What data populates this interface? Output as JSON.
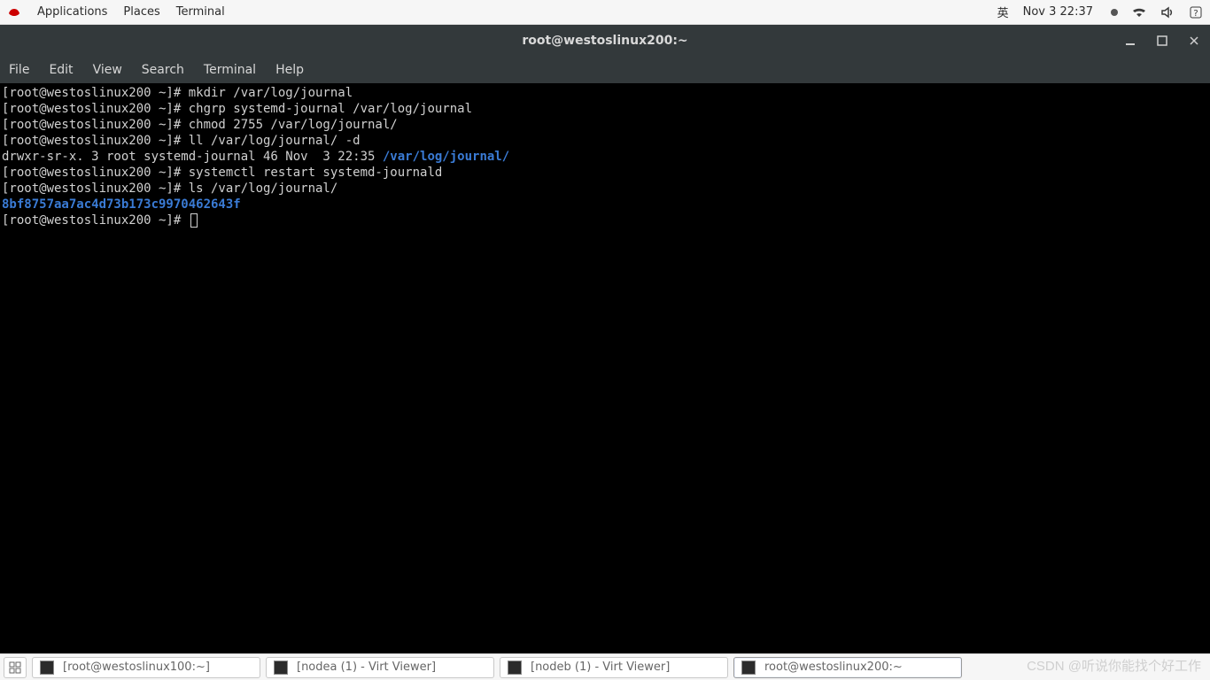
{
  "top_panel": {
    "applications": "Applications",
    "places": "Places",
    "terminal": "Terminal",
    "ime": "英",
    "clock": "Nov 3  22:37"
  },
  "window": {
    "title": "root@westoslinux200:~"
  },
  "menubar": {
    "file": "File",
    "edit": "Edit",
    "view": "View",
    "search": "Search",
    "terminal": "Terminal",
    "help": "Help"
  },
  "terminal": {
    "lines": [
      {
        "prompt": "[root@westoslinux200 ~]# ",
        "cmd": "mkdir /var/log/journal"
      },
      {
        "prompt": "[root@westoslinux200 ~]# ",
        "cmd": "chgrp systemd-journal /var/log/journal"
      },
      {
        "prompt": "[root@westoslinux200 ~]# ",
        "cmd": "chmod 2755 /var/log/journal/"
      },
      {
        "prompt": "[root@westoslinux200 ~]# ",
        "cmd": "ll /var/log/journal/ -d"
      }
    ],
    "ll_out_plain": "drwxr-sr-x. 3 root systemd-journal 46 Nov  3 22:35 ",
    "ll_out_dir": "/var/log/journal/",
    "lines2": [
      {
        "prompt": "[root@westoslinux200 ~]# ",
        "cmd": "systemctl restart systemd-journald"
      },
      {
        "prompt": "[root@westoslinux200 ~]# ",
        "cmd": "ls /var/log/journal/"
      }
    ],
    "ls_out_dir": "8bf8757aa7ac4d73b173c9970462643f",
    "final_prompt": "[root@westoslinux200 ~]# "
  },
  "taskbar": {
    "items": [
      {
        "label": "[root@westoslinux100:~]",
        "active": false
      },
      {
        "label": "[nodea (1) - Virt Viewer]",
        "active": false
      },
      {
        "label": "[nodeb (1) - Virt Viewer]",
        "active": false
      },
      {
        "label": "root@westoslinux200:~",
        "active": true
      }
    ]
  },
  "watermark": "CSDN @听说你能找个好工作"
}
